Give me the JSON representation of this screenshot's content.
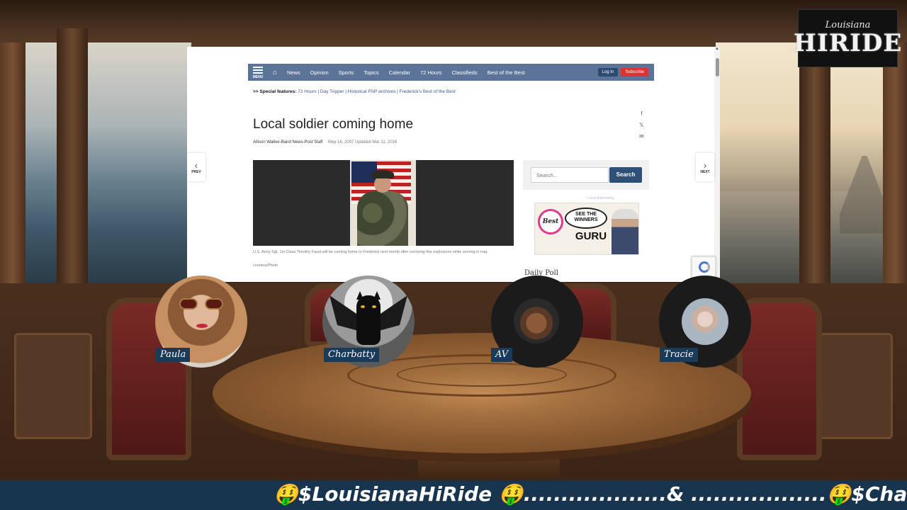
{
  "logo": {
    "top": "Louisiana",
    "main": "HIRIDE"
  },
  "browser": {
    "nav": {
      "menu_label": "MENU",
      "links": [
        "News",
        "Opinion",
        "Sports",
        "Topics",
        "Calendar",
        "72 Hours",
        "Classifieds",
        "Best of the Best"
      ],
      "login": "Log In",
      "subscribe": "Subscribe"
    },
    "special_features": {
      "label": ">> Special features:",
      "links": "72 Hours | Day Tripper | Historical FNP archives | Frederick's Best of the Best"
    },
    "article": {
      "headline": "Local soldier coming home",
      "author": "Allison Walker-Baird News-Post Staff",
      "dates": "May 16, 2007 Updated Mar 11, 2016",
      "caption": "U.S. Army Sgt. 1st Class Timothy Faust will be coming home to Frederick next month after surviving five explosions while serving in Iraq.",
      "credit": "courtesyPhoto"
    },
    "share_icons": [
      "facebook-icon",
      "x-icon",
      "email-icon"
    ],
    "sidebar": {
      "search_placeholder": "Search...",
      "search_button": "Search",
      "ad_label": "Local Advertising",
      "ad": {
        "badge": "Best",
        "speech": "SEE THE WINNERS",
        "brand": "GURU"
      },
      "daily_poll": "Daily Poll"
    },
    "prev_label": "PREV",
    "next_label": "NEXT"
  },
  "participants": [
    {
      "name": "Paula"
    },
    {
      "name": "Charbatty"
    },
    {
      "name": "AV"
    },
    {
      "name": "Tracie"
    }
  ],
  "ticker": {
    "text": "🤑$LouisianaHiRide 🤑...................& ..................🤑$Charbatty"
  },
  "colors": {
    "nav_bar": "#5b7498",
    "search_button": "#2f4f78",
    "ticker_bg": "#18354f",
    "subscribe": "#dd3333"
  }
}
